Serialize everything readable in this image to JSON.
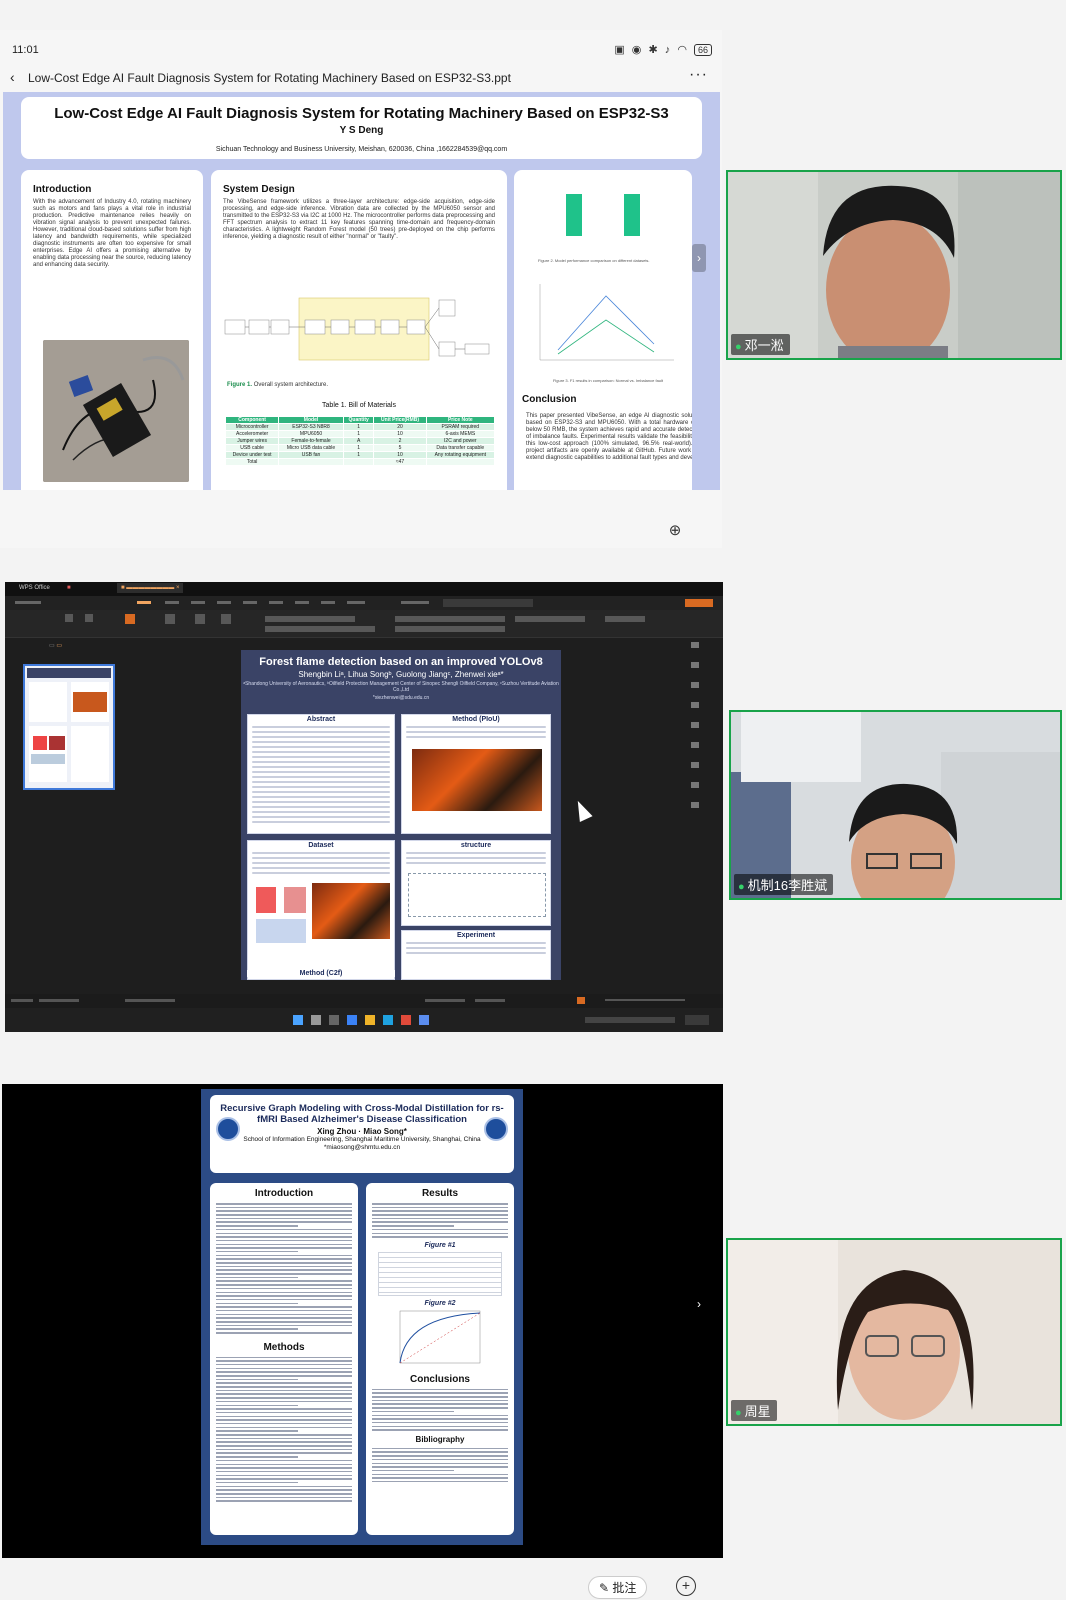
{
  "status_bar": {
    "time": "11:01",
    "battery": "66"
  },
  "viewer": {
    "file_name": "Low-Cost Edge AI Fault Diagnosis System for Rotating Machinery Based on ESP32-S3.ppt"
  },
  "poster1": {
    "title": "Low-Cost Edge AI Fault Diagnosis System for Rotating Machinery Based on ESP32-S3",
    "author": "Y S Deng",
    "affiliation": "Sichuan Technology and Business University, Meishan, 620036, China ,1662284539@qq.com",
    "intro_heading": "Introduction",
    "intro_text": "With the advancement of Industry 4.0, rotating machinery such as motors and fans plays a vital role in industrial production. Predictive maintenance relies heavily on vibration signal analysis to prevent unexpected failures. However, traditional cloud-based solutions suffer from high latency and bandwidth requirements, while specialized diagnostic instruments are often too expensive for small enterprises. Edge AI offers a promising alternative by enabling data processing near the source, reducing latency and enhancing data security.",
    "design_heading": "System Design",
    "design_text": "The VibeSense framework utilizes a three-layer architecture: edge-side acquisition, edge-side processing, and edge-side inference. Vibration data are collected by the MPU6050 sensor and transmitted to the ESP32-S3 via I2C at 1000 Hz. The microcontroller performs data preprocessing and FFT spectrum analysis to extract 11 key features spanning time-domain and frequency-domain characteristics. A lightweight Random Forest model (50 trees) pre-deployed on the chip performs inference, yielding a diagnostic result of either \"normal\" or \"faulty\".",
    "figure_caption_label": "Figure 1.",
    "figure_caption_text": "Overall system architecture.",
    "bom_title": "Table 1. Bill of Materials",
    "bom_header": [
      "Component",
      "Model",
      "Quantity",
      "Unit Price(RMB)",
      "Price Note"
    ],
    "bom_rows": [
      [
        "Microcontroller",
        "ESP32-S3 N8R8",
        "1",
        "20",
        "PSRAM required"
      ],
      [
        "Accelerometer",
        "MPU6050",
        "1",
        "10",
        "6-axis MEMS"
      ],
      [
        "Jumper wires",
        "Female-to-female",
        "A",
        "2",
        "I2C and power"
      ],
      [
        "USB cable",
        "Micro USB data cable",
        "1",
        "5",
        "Data transfer capable"
      ],
      [
        "Device under test",
        "USB fan",
        "1",
        "10",
        "Any rotating equipment"
      ],
      [
        "Total",
        "",
        "",
        "≈47",
        ""
      ]
    ],
    "chart_caption_1": "Figure 2. Model performance comparison on different datasets.",
    "chart_caption_2": "Figure 3. F1 results in comparison: Normal vs. Imbalance fault",
    "conclusion_heading": "Conclusion",
    "conclusion_text": "This paper presented VibeSense, an edge AI diagnostic solution based on ESP32-S3 and MPU6050. With a total hardware cost below 50 RMB, the system achieves rapid and accurate detection of imbalance faults. Experimental results validate the feasibility of this low-cost approach (100% simulated, 96.5% real-world). All project artifacts are openly available at GitHub. Future work will extend diagnostic capabilities to additional fault types and develop"
  },
  "participants": [
    {
      "name": "邓一淞"
    },
    {
      "name": "机制16李胜斌"
    },
    {
      "name": "周星"
    }
  ],
  "poster2": {
    "app_tab": "WPS Office",
    "title": "Forest flame detection based on an improved YOLOv8",
    "authors": "Shengbin Liᵃ, Lihua Songᵇ, Guolong Jiangᶜ, Zhenwei xieᵃ*",
    "affiliation": "ᵃShandong University of Aeronautics, ᵇOilfield Protection Management Center of Sinopec Shengli Oilfield Company, ᶜSuzhou Vertitude Aviation Co.,Ltd",
    "email": "*xiezhenwei@sdu.edu.cn",
    "sections": [
      "Abstract",
      "Method (PIoU)",
      "Dataset",
      "structure",
      "Experiment",
      "Method (C2f)"
    ]
  },
  "poster3": {
    "title": "Recursive Graph Modeling with Cross-Modal Distillation for rs-fMRI Based Alzheimer's Disease Classification",
    "authors": "Xing Zhou · Miao Song*",
    "affiliation": "School of Information Engineering, Shanghai Maritime University, Shanghai, China",
    "email": "*miaosong@shmtu.edu.cn",
    "sections_left": [
      "Introduction",
      "Methods"
    ],
    "sections_right": [
      "Results",
      "Conclusions",
      "Bibliography"
    ],
    "figures": [
      "Figure #1",
      "Figure #2"
    ]
  },
  "bottom_bar": {
    "annotate_label": "批注"
  },
  "colors": {
    "tile_border": "#19a34a",
    "poster1_bg": "#bfc8ed",
    "bom_header": "#2fb57e",
    "poster3_bg": "#2c4b85"
  }
}
